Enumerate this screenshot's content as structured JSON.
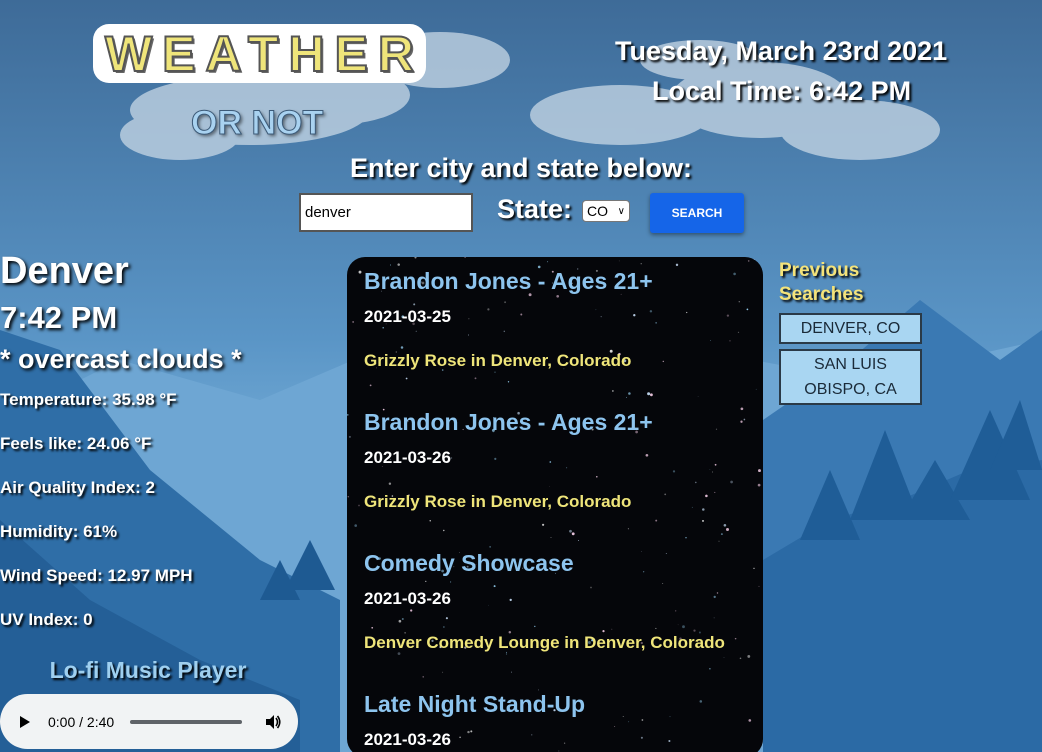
{
  "header": {
    "logo_text": "WEATHER",
    "logo_sub": "OR NOT",
    "date": "Tuesday, March 23rd 2021",
    "local_time": "Local Time: 6:42 PM"
  },
  "search": {
    "prompt": "Enter city and state below:",
    "city_value": "denver",
    "state_label": "State:",
    "state_selected": "CO",
    "button_label": "SEARCH"
  },
  "weather": {
    "city": "Denver",
    "time": "7:42 PM",
    "description": "* overcast clouds *",
    "stats": [
      "Temperature: 35.98 °F",
      "Feels like: 24.06 °F",
      "Air Quality Index: 2",
      "Humidity: 61%",
      "Wind Speed: 12.97 MPH",
      "UV Index: 0"
    ]
  },
  "music": {
    "title": "Lo-fi Music Player",
    "time": "0:00 / 2:40"
  },
  "events": [
    {
      "title": "Brandon Jones - Ages 21+",
      "date": "2021-03-25",
      "venue": "Grizzly Rose in Denver, Colorado"
    },
    {
      "title": "Brandon Jones - Ages 21+",
      "date": "2021-03-26",
      "venue": "Grizzly Rose in Denver, Colorado"
    },
    {
      "title": "Comedy Showcase",
      "date": "2021-03-26",
      "venue": "Denver Comedy Lounge in Denver, Colorado"
    },
    {
      "title": "Late Night Stand-Up",
      "date": "2021-03-26",
      "venue": ""
    }
  ],
  "previous": {
    "title_line1": "Previous",
    "title_line2": "Searches",
    "items": [
      "DENVER, CO",
      "SAN LUIS OBISPO, CA"
    ]
  },
  "icons": {
    "play": "play-icon",
    "volume": "volume-icon",
    "chevron": "chevron-down-icon"
  }
}
